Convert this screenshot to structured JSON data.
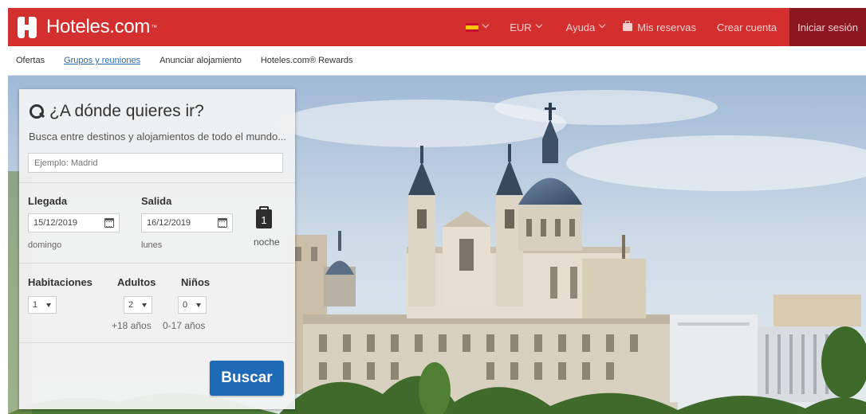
{
  "header": {
    "brand": "Hoteles.com",
    "brand_tm": "™",
    "currency": "EUR",
    "help": "Ayuda",
    "bookings": "Mis reservas",
    "create_account": "Crear cuenta",
    "sign_in": "Iniciar sesión",
    "accent": "#d32f2f",
    "signin_bg": "#8b1820"
  },
  "subnav": {
    "items": [
      "Ofertas",
      "Grupos y reuniones",
      "Anunciar alojamiento",
      "Hoteles.com® Rewards"
    ],
    "active_index": 1
  },
  "search": {
    "title": "¿A dónde quieres ir?",
    "subtitle": "Busca entre destinos y alojamientos de todo el mundo...",
    "destination_placeholder": "Ejemplo: Madrid",
    "checkin_label": "Llegada",
    "checkout_label": "Salida",
    "checkin_date": "15/12/2019",
    "checkout_date": "16/12/2019",
    "checkin_day": "domingo",
    "checkout_day": "lunes",
    "nights": "1",
    "nights_label": "noche",
    "rooms_label": "Habitaciones",
    "adults_label": "Adultos",
    "children_label": "Niños",
    "rooms_value": "1",
    "adults_value": "2",
    "children_value": "0",
    "adults_hint": "+18 años",
    "children_hint": "0-17 años",
    "submit_label": "Buscar",
    "button_color": "#1f6ab7"
  },
  "icons": {
    "logo": "hotels-h-logo",
    "language": "spain-flag-icon",
    "bookings": "briefcase-icon",
    "search": "search-icon",
    "calendar": "calendar-icon",
    "nights": "night-counter-icon"
  }
}
